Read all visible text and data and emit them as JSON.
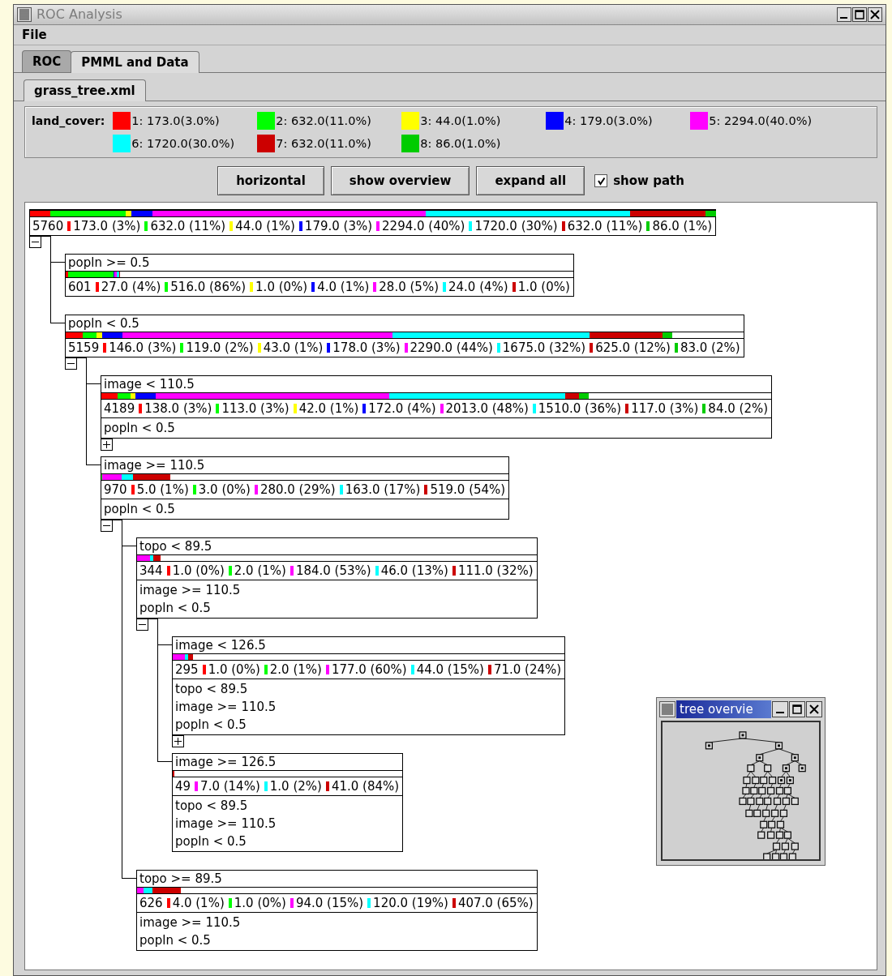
{
  "window": {
    "title": "ROC Analysis"
  },
  "menu": [
    "File"
  ],
  "tabs": [
    {
      "label": "ROC",
      "selected": false
    },
    {
      "label": "PMML and Data",
      "selected": true
    }
  ],
  "file_tabs": [
    {
      "label": "grass_tree.xml",
      "selected": true
    }
  ],
  "legend": {
    "label": "land_cover:",
    "items": [
      {
        "color": "#ff0000",
        "text": "1: 173.0(3.0%)"
      },
      {
        "color": "#00ff00",
        "text": "2: 632.0(11.0%)"
      },
      {
        "color": "#ffff00",
        "text": "3: 44.0(1.0%)"
      },
      {
        "color": "#0000ff",
        "text": "4: 179.0(3.0%)"
      },
      {
        "color": "#ff00ff",
        "text": "5: 2294.0(40.0%)"
      },
      {
        "color": "#00ffff",
        "text": "6: 1720.0(30.0%)"
      },
      {
        "color": "#cc0000",
        "text": "7: 632.0(11.0%)"
      },
      {
        "color": "#00cc00",
        "text": "8: 86.0(1.0%)"
      }
    ]
  },
  "toolbar": {
    "buttons": [
      "horizontal",
      "show overview",
      "expand all"
    ],
    "show_path": {
      "label": "show path",
      "checked": true
    }
  },
  "tree": {
    "kind": "branch",
    "expanded": true,
    "total": "5760",
    "counts": [
      {
        "color": "#ff0000",
        "text": "173.0 (3%)"
      },
      {
        "color": "#00ff00",
        "text": "632.0 (11%)"
      },
      {
        "color": "#ffff00",
        "text": "44.0 (1%)"
      },
      {
        "color": "#0000ff",
        "text": "179.0 (3%)"
      },
      {
        "color": "#ff00ff",
        "text": "2294.0 (40%)"
      },
      {
        "color": "#00ffff",
        "text": "1720.0 (30%)"
      },
      {
        "color": "#cc0000",
        "text": "632.0 (11%)"
      },
      {
        "color": "#00cc00",
        "text": "86.0 (1%)"
      }
    ],
    "children": [
      {
        "kind": "leaf",
        "condition": "popln >= 0.5",
        "total": "601",
        "counts": [
          {
            "color": "#ff0000",
            "text": "27.0 (4%)"
          },
          {
            "color": "#00ff00",
            "text": "516.0 (86%)"
          },
          {
            "color": "#ffff00",
            "text": "1.0 (0%)"
          },
          {
            "color": "#0000ff",
            "text": "4.0 (1%)"
          },
          {
            "color": "#ff00ff",
            "text": "28.0 (5%)"
          },
          {
            "color": "#00ffff",
            "text": "24.0 (4%)"
          },
          {
            "color": "#cc0000",
            "text": "1.0 (0%)"
          }
        ]
      },
      {
        "kind": "branch",
        "condition": "popln < 0.5",
        "expanded": true,
        "total": "5159",
        "counts": [
          {
            "color": "#ff0000",
            "text": "146.0 (3%)"
          },
          {
            "color": "#00ff00",
            "text": "119.0 (2%)"
          },
          {
            "color": "#ffff00",
            "text": "43.0 (1%)"
          },
          {
            "color": "#0000ff",
            "text": "178.0 (3%)"
          },
          {
            "color": "#ff00ff",
            "text": "2290.0 (44%)"
          },
          {
            "color": "#00ffff",
            "text": "1675.0 (32%)"
          },
          {
            "color": "#cc0000",
            "text": "625.0 (12%)"
          },
          {
            "color": "#00cc00",
            "text": "83.0 (2%)"
          }
        ],
        "children": [
          {
            "kind": "branch",
            "condition": "image < 110.5",
            "expanded": false,
            "total": "4189",
            "counts": [
              {
                "color": "#ff0000",
                "text": "138.0 (3%)"
              },
              {
                "color": "#00ff00",
                "text": "113.0 (3%)"
              },
              {
                "color": "#ffff00",
                "text": "42.0 (1%)"
              },
              {
                "color": "#0000ff",
                "text": "172.0 (4%)"
              },
              {
                "color": "#ff00ff",
                "text": "2013.0 (48%)"
              },
              {
                "color": "#00ffff",
                "text": "1510.0 (36%)"
              },
              {
                "color": "#cc0000",
                "text": "117.0 (3%)"
              },
              {
                "color": "#00cc00",
                "text": "84.0 (2%)"
              }
            ],
            "path": [
              "popln < 0.5"
            ]
          },
          {
            "kind": "branch",
            "condition": "image >= 110.5",
            "expanded": true,
            "total": "970",
            "counts": [
              {
                "color": "#ff0000",
                "text": "5.0 (1%)"
              },
              {
                "color": "#00ff00",
                "text": "3.0 (0%)"
              },
              {
                "color": "#ff00ff",
                "text": "280.0 (29%)"
              },
              {
                "color": "#00ffff",
                "text": "163.0 (17%)"
              },
              {
                "color": "#cc0000",
                "text": "519.0 (54%)"
              }
            ],
            "path": [
              "popln < 0.5"
            ],
            "children": [
              {
                "kind": "branch",
                "condition": "topo < 89.5",
                "expanded": true,
                "total": "344",
                "counts": [
                  {
                    "color": "#ff0000",
                    "text": "1.0 (0%)"
                  },
                  {
                    "color": "#00ff00",
                    "text": "2.0 (1%)"
                  },
                  {
                    "color": "#ff00ff",
                    "text": "184.0 (53%)"
                  },
                  {
                    "color": "#00ffff",
                    "text": "46.0 (13%)"
                  },
                  {
                    "color": "#cc0000",
                    "text": "111.0 (32%)"
                  }
                ],
                "path": [
                  "image >= 110.5",
                  "popln < 0.5"
                ],
                "children": [
                  {
                    "kind": "branch",
                    "condition": "image < 126.5",
                    "expanded": false,
                    "total": "295",
                    "counts": [
                      {
                        "color": "#ff0000",
                        "text": "1.0 (0%)"
                      },
                      {
                        "color": "#00ff00",
                        "text": "2.0 (1%)"
                      },
                      {
                        "color": "#ff00ff",
                        "text": "177.0 (60%)"
                      },
                      {
                        "color": "#00ffff",
                        "text": "44.0 (15%)"
                      },
                      {
                        "color": "#cc0000",
                        "text": "71.0 (24%)"
                      }
                    ],
                    "path": [
                      "topo < 89.5",
                      "image >= 110.5",
                      "popln < 0.5"
                    ]
                  },
                  {
                    "kind": "leaf",
                    "condition": "image >= 126.5",
                    "total": "49",
                    "counts": [
                      {
                        "color": "#ff00ff",
                        "text": "7.0 (14%)"
                      },
                      {
                        "color": "#00ffff",
                        "text": "1.0 (2%)"
                      },
                      {
                        "color": "#cc0000",
                        "text": "41.0 (84%)"
                      }
                    ],
                    "path": [
                      "topo < 89.5",
                      "image >= 110.5",
                      "popln < 0.5"
                    ]
                  }
                ]
              },
              {
                "kind": "leaf",
                "condition": "topo >= 89.5",
                "total": "626",
                "counts": [
                  {
                    "color": "#ff0000",
                    "text": "4.0 (1%)"
                  },
                  {
                    "color": "#00ff00",
                    "text": "1.0 (0%)"
                  },
                  {
                    "color": "#ff00ff",
                    "text": "94.0 (15%)"
                  },
                  {
                    "color": "#00ffff",
                    "text": "120.0 (19%)"
                  },
                  {
                    "color": "#cc0000",
                    "text": "407.0 (65%)"
                  }
                ],
                "path": [
                  "image >= 110.5",
                  "popln < 0.5"
                ]
              }
            ]
          }
        ]
      }
    ]
  },
  "overview": {
    "title": "tree overvie"
  }
}
